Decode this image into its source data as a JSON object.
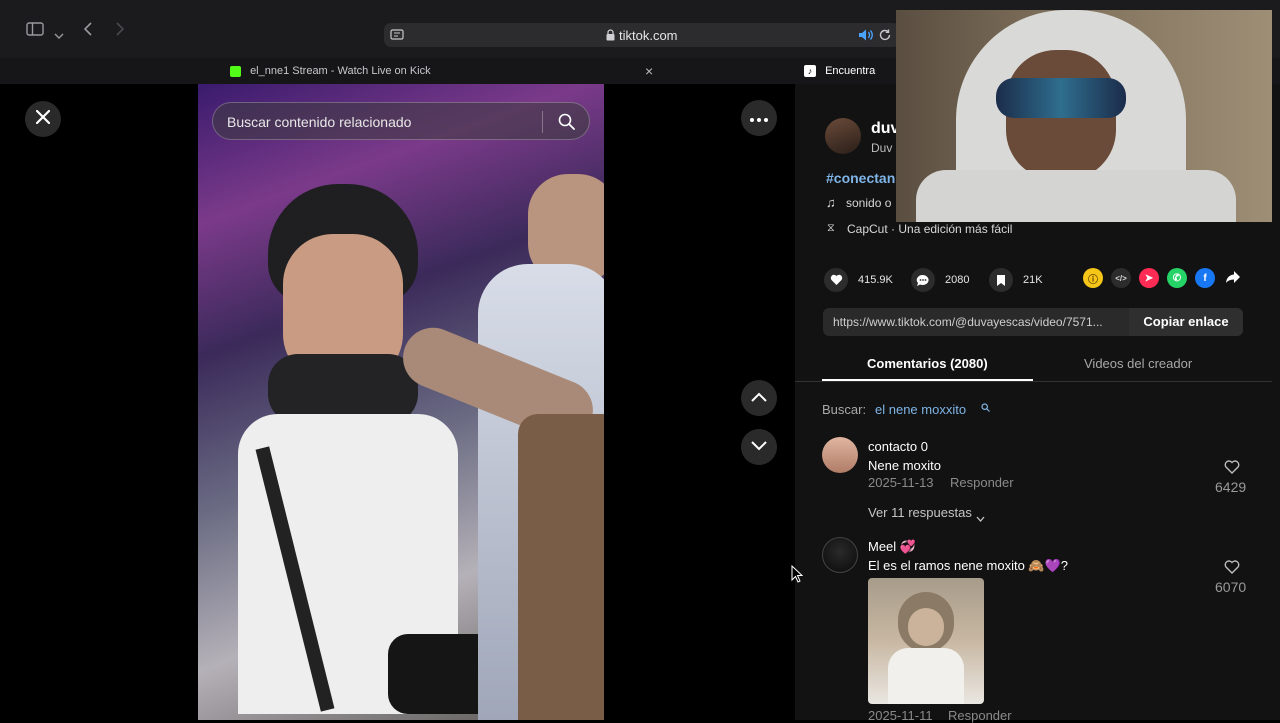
{
  "browser": {
    "url": "tiktok.com",
    "tabs": [
      {
        "label": "el_nne1 Stream - Watch Live on Kick"
      },
      {
        "label": "Encuentra 'duva"
      }
    ]
  },
  "video": {
    "search_placeholder": "Buscar contenido relacionado"
  },
  "creator": {
    "name": "duv",
    "subtitle": "Duv",
    "hashtag": "#conectan",
    "sound": "sonido o",
    "capcut": "CapCut · Una edición más fácil"
  },
  "stats": {
    "likes": "415.9K",
    "comments": "2080",
    "saves": "21K"
  },
  "link": {
    "url": "https://www.tiktok.com/@duvayescas/video/7571...",
    "copy_label": "Copiar enlace"
  },
  "panel_tabs": {
    "comments": "Comentarios (2080)",
    "creator_videos": "Videos del creador"
  },
  "search_hint": {
    "prefix": "Buscar:",
    "query": "el nene moxxito"
  },
  "comments": [
    {
      "user": "contacto 0",
      "text": "Nene moxito",
      "date": "2025-11-13",
      "reply": "Responder",
      "likes": "6429",
      "replies_link": "Ver 11 respuestas"
    },
    {
      "user": "Meel 💞",
      "text": "El es el ramos nene moxito 🙈💜?",
      "date": "2025-11-11",
      "reply": "Responder",
      "likes": "6070"
    }
  ],
  "colors": {
    "accent_blue": "#7fb4e6",
    "panel_bg": "#121212"
  }
}
